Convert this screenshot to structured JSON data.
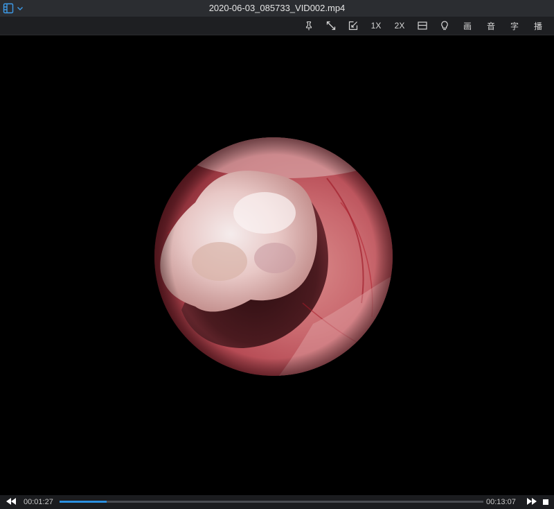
{
  "window": {
    "title": "2020-06-03_085733_VID002.mp4"
  },
  "titlebar": {
    "menu_icon": "playlist-icon",
    "dropdown_icon": "chevron-down-icon"
  },
  "toolbar": {
    "items": [
      {
        "kind": "icon",
        "name": "pin-icon"
      },
      {
        "kind": "icon",
        "name": "fullscreen-icon"
      },
      {
        "kind": "icon",
        "name": "edit-box-icon"
      },
      {
        "kind": "text",
        "label": "1X"
      },
      {
        "kind": "text",
        "label": "2X"
      },
      {
        "kind": "icon",
        "name": "window-icon"
      },
      {
        "kind": "icon",
        "name": "lightbulb-icon"
      },
      {
        "kind": "text",
        "label": "画"
      },
      {
        "kind": "text",
        "label": "音"
      },
      {
        "kind": "text",
        "label": "字"
      },
      {
        "kind": "text",
        "label": "播"
      }
    ]
  },
  "playback": {
    "current_time": "00:01:27",
    "total_time": "00:13:07",
    "progress_fraction": 0.111
  },
  "colors": {
    "accent": "#2a8fe0",
    "titlebar_bg": "#2b2d31",
    "toolbar_bg": "#1e1f22",
    "controls_bg": "#1b1c1f"
  }
}
